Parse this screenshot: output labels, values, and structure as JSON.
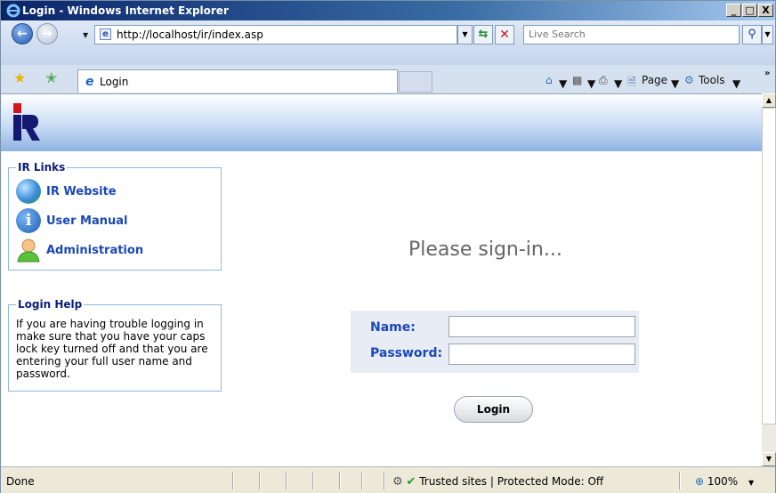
{
  "window": {
    "title": "Login - Windows Internet Explorer",
    "minimize": "_",
    "maximize": "□",
    "close": "X"
  },
  "address": {
    "url": "http://localhost/ir/index.asp",
    "search_placeholder": "Live Search"
  },
  "tab": {
    "label": "Login"
  },
  "command_bar": {
    "page": "Page",
    "tools": "Tools"
  },
  "sidebar": {
    "links_title": "IR Links",
    "links": [
      {
        "label": "IR Website",
        "icon": "globe-icon"
      },
      {
        "label": "User Manual",
        "icon": "info-icon"
      },
      {
        "label": "Administration",
        "icon": "user-icon"
      }
    ],
    "help_title": "Login Help",
    "help_text": "If you are having trouble logging in make sure that you have your caps lock key turned off and that you are entering your full user name and password."
  },
  "main": {
    "heading": "Please sign-in...",
    "name_label": "Name:",
    "password_label": "Password:",
    "name_value": "",
    "password_value": "",
    "login_button": "Login"
  },
  "status": {
    "text": "Done",
    "zone": "Trusted sites | Protected Mode: Off",
    "zoom": "100%"
  },
  "colors": {
    "link_blue": "#1a48b8",
    "legend_navy": "#0a1e7a",
    "logo_red": "#d4141c",
    "logo_navy": "#14186e"
  }
}
